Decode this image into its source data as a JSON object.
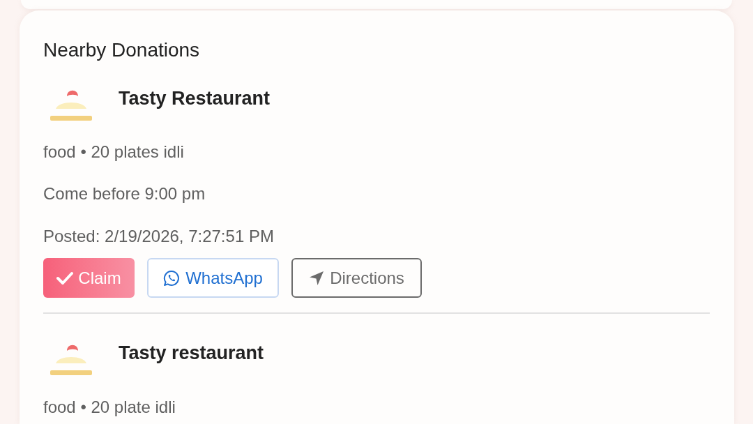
{
  "section": {
    "title": "Nearby Donations"
  },
  "donations": [
    {
      "donor": "Tasty Restaurant",
      "summary": "food • 20 plates idli",
      "note": "Come before 9:00 pm",
      "posted": "Posted: 2/19/2026, 7:27:51 PM",
      "actions": [
        {
          "kind": "claim",
          "label": "Claim"
        },
        {
          "kind": "whatsapp",
          "label": "WhatsApp"
        },
        {
          "kind": "directions",
          "label": "Directions"
        }
      ]
    },
    {
      "donor": "Tasty restaurant",
      "summary": "food • 20 plate idli"
    }
  ]
}
